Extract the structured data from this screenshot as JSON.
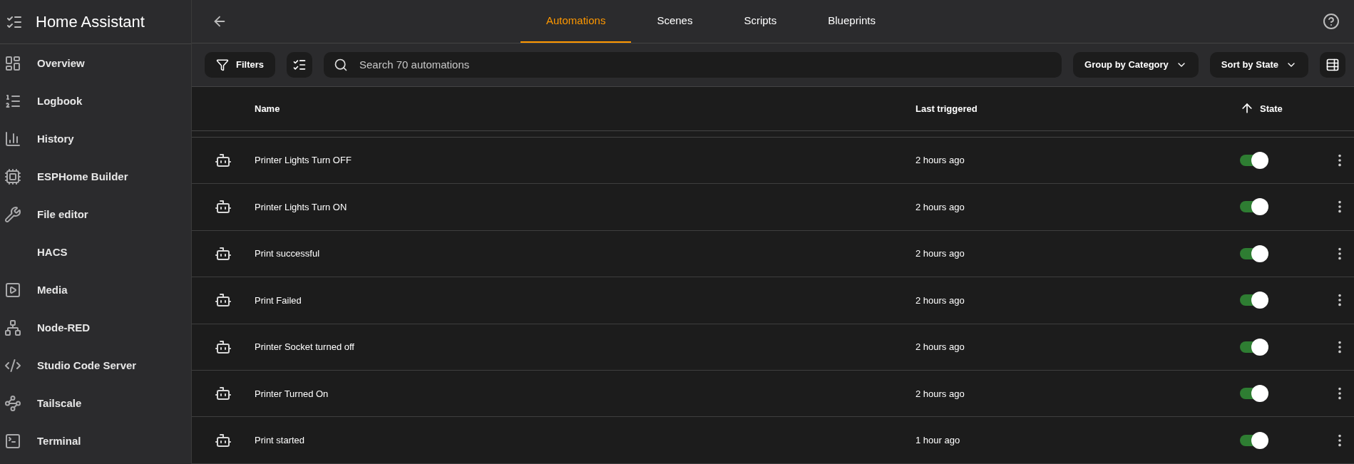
{
  "sidebar": {
    "title": "Home Assistant",
    "items": [
      {
        "label": "Overview",
        "selected": false
      },
      {
        "label": "Logbook",
        "selected": false
      },
      {
        "label": "History",
        "selected": false
      },
      {
        "label": "ESPHome Builder",
        "selected": false
      },
      {
        "label": "File editor",
        "selected": false
      },
      {
        "label": "HACS",
        "selected": false
      },
      {
        "label": "Media",
        "selected": false
      },
      {
        "label": "Node-RED",
        "selected": false
      },
      {
        "label": "Studio Code Server",
        "selected": false
      },
      {
        "label": "Tailscale",
        "selected": false
      },
      {
        "label": "Terminal",
        "selected": false
      }
    ]
  },
  "tabs": [
    {
      "label": "Automations",
      "selected": true
    },
    {
      "label": "Scenes",
      "selected": false
    },
    {
      "label": "Scripts",
      "selected": false
    },
    {
      "label": "Blueprints",
      "selected": false
    }
  ],
  "toolbar": {
    "filters": "Filters",
    "search": {
      "placeholder": "Search 70 automations"
    },
    "group": "Group by Category",
    "sort": "Sort by State"
  },
  "table": {
    "columns": [
      "Name",
      "Last triggered",
      "State"
    ],
    "rows": [
      {
        "name": "Printer Lights Turn OFF",
        "last_triggered": "2 hours ago",
        "on": true
      },
      {
        "name": "Printer Lights Turn ON",
        "last_triggered": "2 hours ago",
        "on": true
      },
      {
        "name": "Print successful",
        "last_triggered": "2 hours ago",
        "on": true
      },
      {
        "name": "Print Failed",
        "last_triggered": "2 hours ago",
        "on": true
      },
      {
        "name": "Printer Socket turned off",
        "last_triggered": "2 hours ago",
        "on": true
      },
      {
        "name": "Printer Turned On",
        "last_triggered": "2 hours ago",
        "on": true
      },
      {
        "name": "Print started",
        "last_triggered": "1 hour ago",
        "on": true
      }
    ]
  }
}
